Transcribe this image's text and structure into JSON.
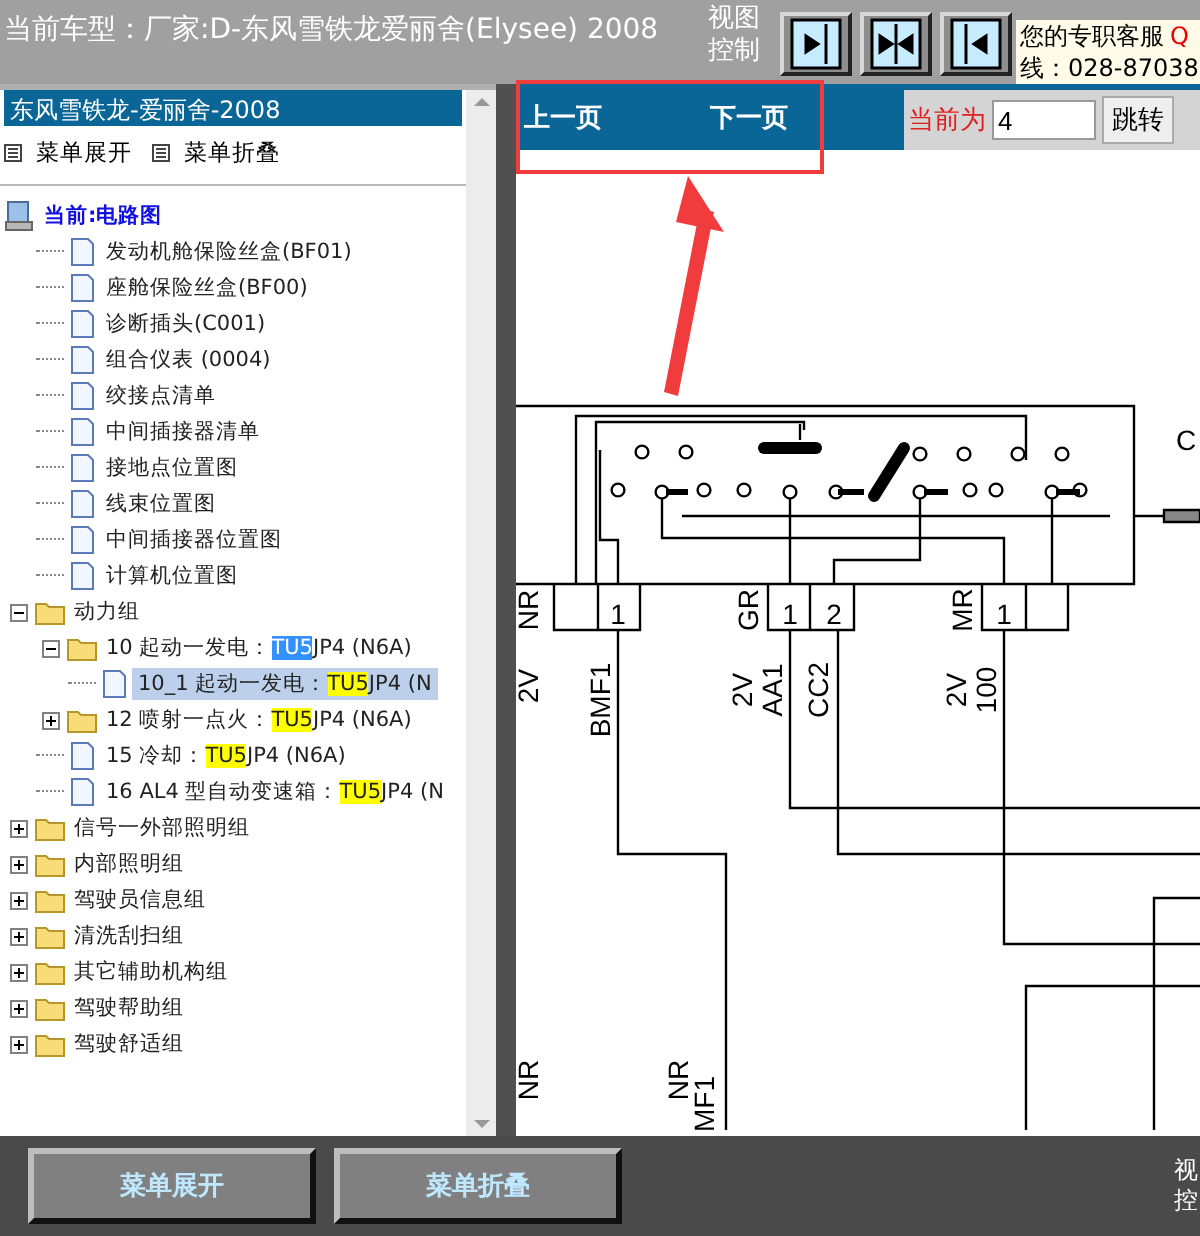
{
  "top_bar": {
    "vehicle_label": "当前车型：厂家:D-东风雪铁龙爱丽舍(Elysee)   2008",
    "view_control_label": [
      "视图",
      "控制"
    ],
    "view_buttons": [
      {
        "kind": "right"
      },
      {
        "kind": "both"
      },
      {
        "kind": "left"
      }
    ],
    "contact": {
      "title": "您的专职客服",
      "link": "Q",
      "phone": "线：028-87038"
    }
  },
  "left_panel": {
    "title": "东风雪铁龙-爱丽舍-2008",
    "menu_actions": [
      "菜单展开",
      "菜单折叠"
    ],
    "tree": [
      {
        "kind": "root",
        "label": "当前:电路图",
        "selected": false,
        "children": [
          {
            "kind": "page",
            "label": "发动机舱保险丝盒(BF01)",
            "selected": false
          },
          {
            "kind": "page",
            "label": "座舱保险丝盒(BF00)",
            "selected": false
          },
          {
            "kind": "page",
            "label": "诊断插头(C001)",
            "selected": false
          },
          {
            "kind": "page",
            "label": "组合仪表 (0004)",
            "selected": false
          },
          {
            "kind": "page",
            "label": "绞接点清单",
            "selected": false
          },
          {
            "kind": "page",
            "label": "中间插接器清单",
            "selected": false
          },
          {
            "kind": "page",
            "label": "接地点位置图",
            "selected": false
          },
          {
            "kind": "page",
            "label": "线束位置图",
            "selected": false
          },
          {
            "kind": "page",
            "label": "中间插接器位置图",
            "selected": false
          },
          {
            "kind": "page",
            "label": "计算机位置图",
            "selected": false
          }
        ]
      },
      {
        "kind": "folder",
        "label": "动力组",
        "expanded": true,
        "selected": false,
        "children": [
          {
            "kind": "folder",
            "label": "10 起动一发电：",
            "match": "TU5",
            "match_current": true,
            "rest": "JP4 (N6A)",
            "expanded": true,
            "selected": false,
            "children": [
              {
                "kind": "page",
                "label": "10_1 起动一发电：",
                "match": "TU5",
                "match_current": false,
                "rest": "JP4 (N",
                "selected": true
              }
            ]
          },
          {
            "kind": "folder",
            "label": "12 喷射一点火：",
            "match": "TU5",
            "match_current": false,
            "rest": "JP4 (N6A)",
            "expanded": false,
            "selected": false
          },
          {
            "kind": "page",
            "label": "15 冷却：",
            "match": "TU5",
            "match_current": false,
            "rest": "JP4 (N6A)",
            "selected": false
          },
          {
            "kind": "page",
            "label": "16 AL4 型自动变速箱：",
            "match": "TU5",
            "match_current": false,
            "rest": "JP4 (N",
            "selected": false
          }
        ]
      },
      {
        "kind": "folder",
        "label": "信号一外部照明组",
        "expanded": false,
        "selected": false
      },
      {
        "kind": "folder",
        "label": "内部照明组",
        "expanded": false,
        "selected": false
      },
      {
        "kind": "folder",
        "label": "驾驶员信息组",
        "expanded": false,
        "selected": false
      },
      {
        "kind": "folder",
        "label": "清洗刮扫组",
        "expanded": false,
        "selected": false
      },
      {
        "kind": "folder",
        "label": "其它辅助机构组",
        "expanded": false,
        "selected": false
      },
      {
        "kind": "folder",
        "label": "驾驶帮助组",
        "expanded": false,
        "selected": false
      },
      {
        "kind": "folder",
        "label": "驾驶舒适组",
        "expanded": false,
        "selected": false
      }
    ]
  },
  "pager": {
    "prev": "上一页",
    "next": "下一页",
    "current_label": "当前为",
    "current_value": "4",
    "jump": "跳转"
  },
  "diagram": {
    "labels": [
      {
        "text": "NR"
      },
      {
        "text": "2V"
      },
      {
        "text": "BMF1"
      },
      {
        "text": "GR"
      },
      {
        "text": "2V"
      },
      {
        "text": "AA1"
      },
      {
        "text": "CC2"
      },
      {
        "text": "MR"
      },
      {
        "text": "2V"
      },
      {
        "text": "100"
      },
      {
        "text": "NR"
      },
      {
        "text": "NR"
      },
      {
        "text": "MF1"
      },
      {
        "text": "C"
      }
    ],
    "pins": [
      "1",
      "1",
      "2",
      "1"
    ]
  },
  "bottom_bar": {
    "buttons": [
      "菜单展开",
      "菜单折叠"
    ],
    "view_control_label": [
      "视",
      "控"
    ]
  }
}
